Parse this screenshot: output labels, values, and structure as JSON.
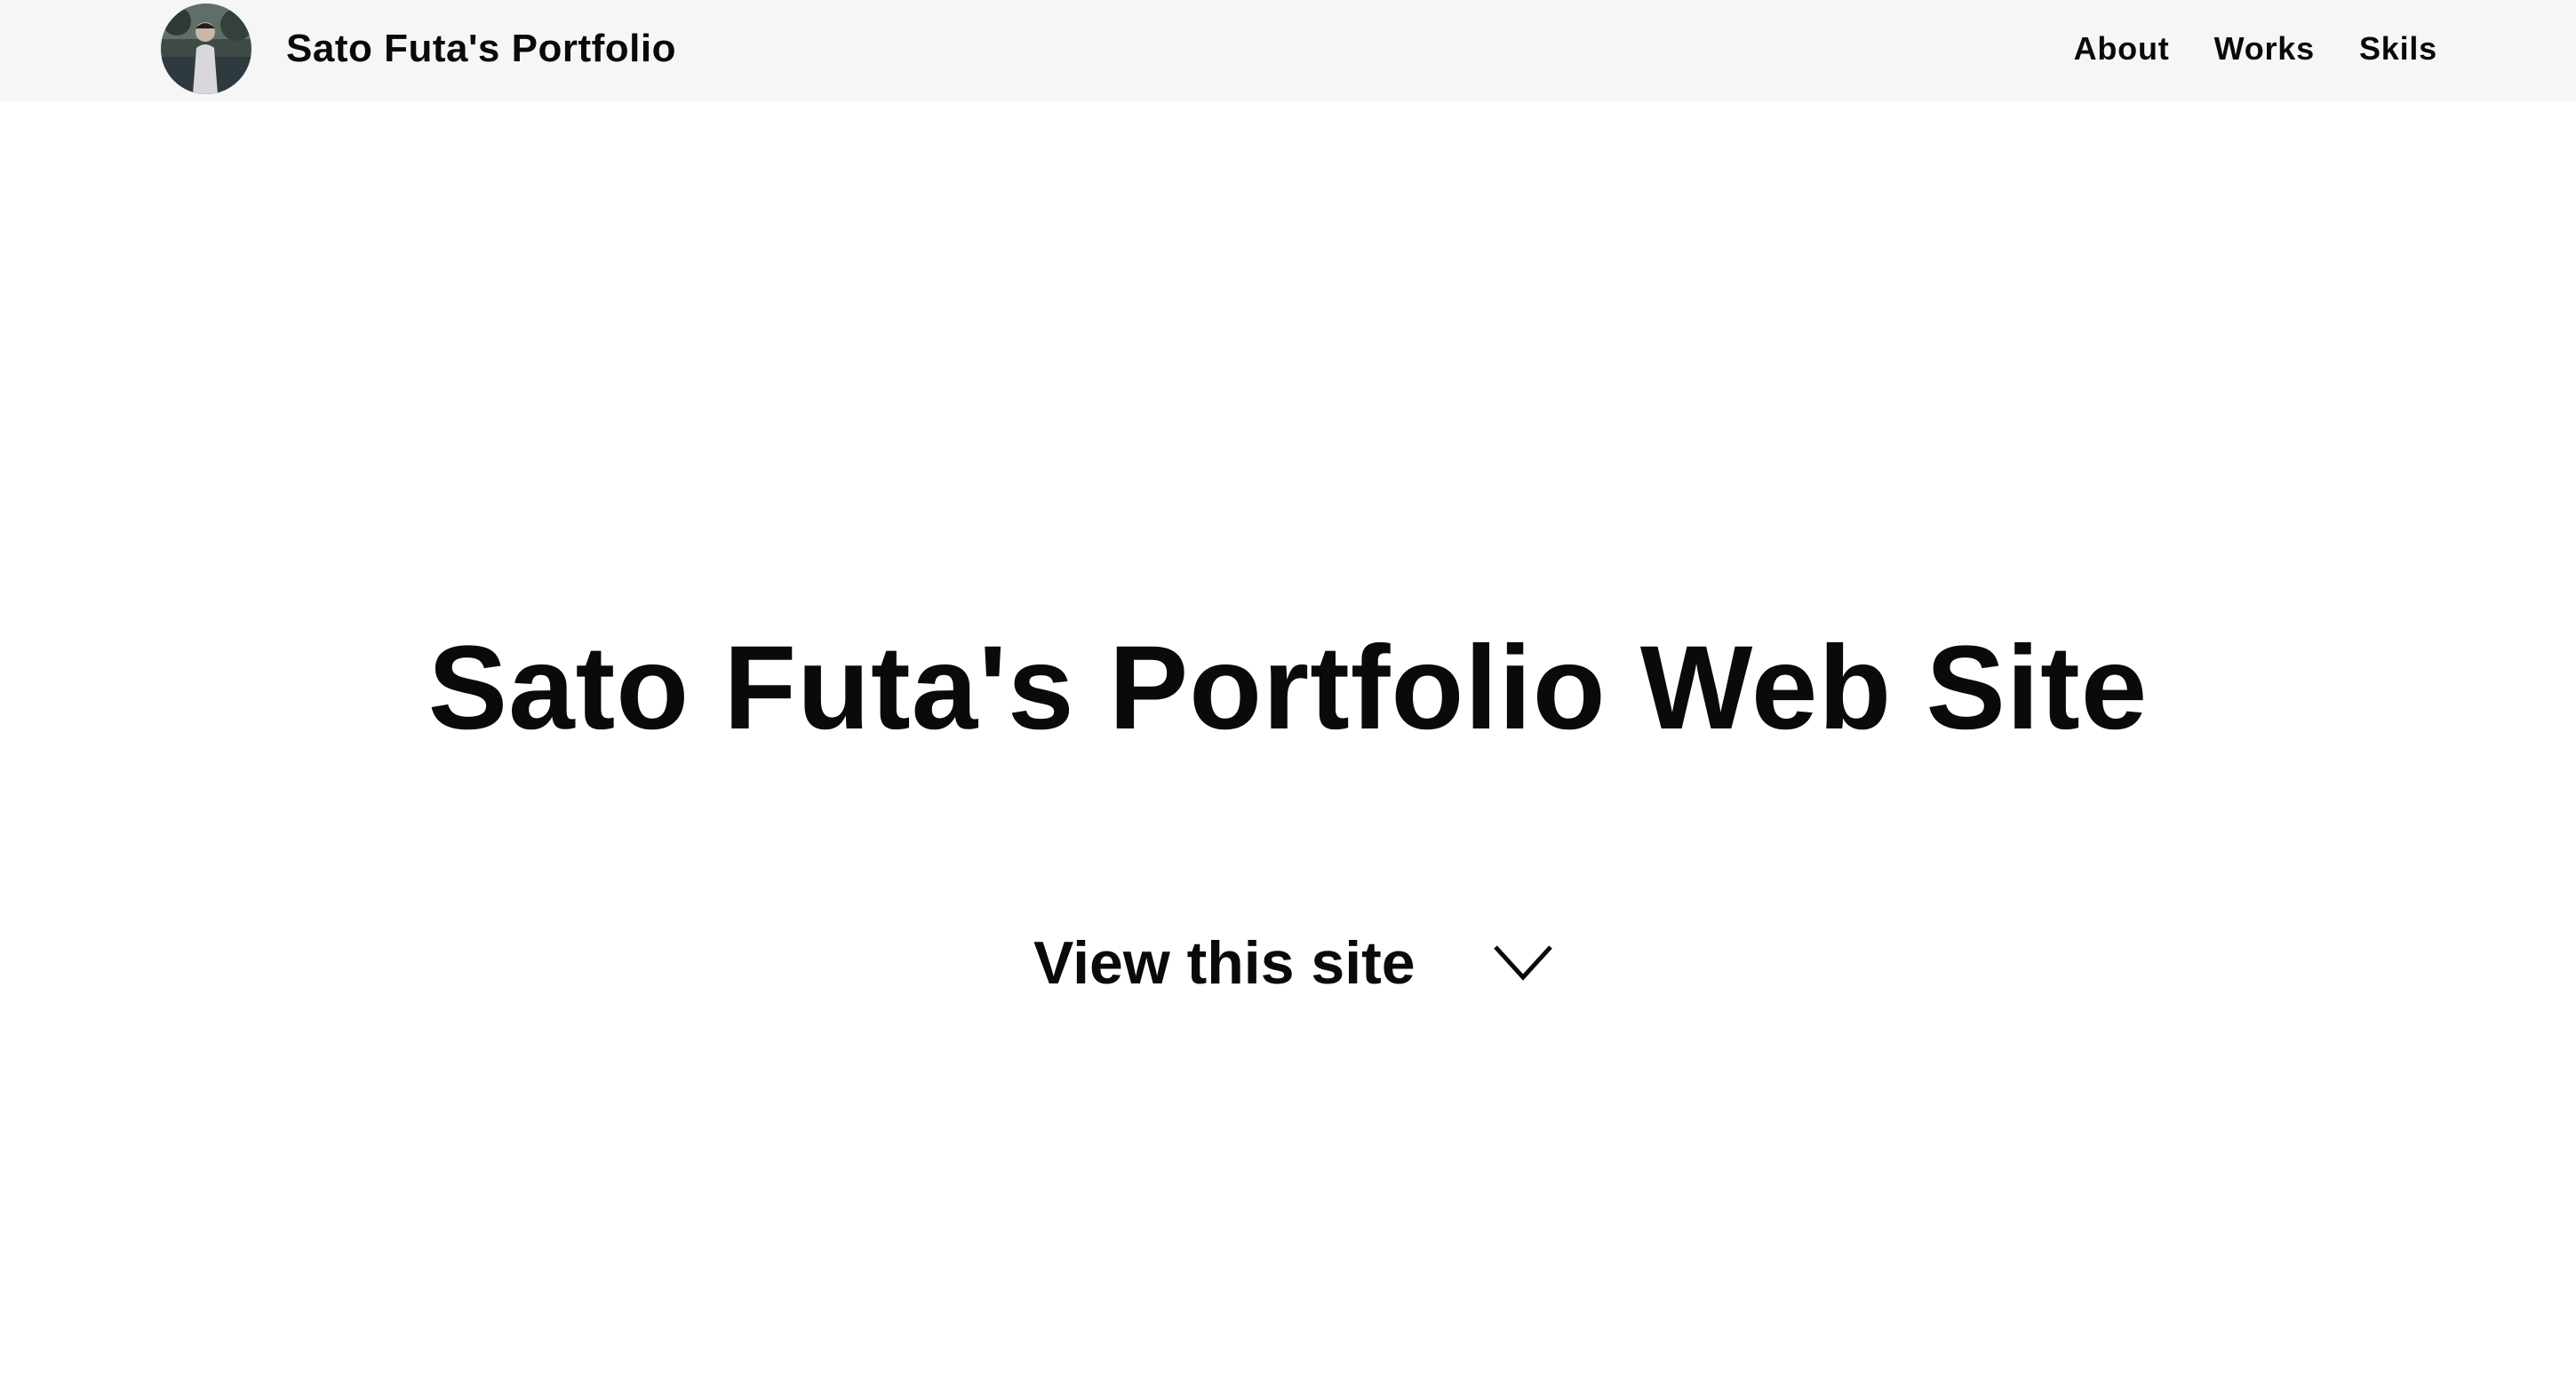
{
  "header": {
    "avatar_icon": "profile-photo",
    "site_title": "Sato Futa's Portfolio",
    "nav": [
      {
        "label": "About"
      },
      {
        "label": "Works"
      },
      {
        "label": "Skils"
      }
    ]
  },
  "hero": {
    "title": "Sato Futa's Portfolio Web Site",
    "cta_label": "View this site",
    "cta_icon": "chevron-down-icon"
  },
  "colors": {
    "header_bg": "#f6f6f6",
    "page_bg": "#ffffff",
    "text": "#0a0a0a"
  }
}
